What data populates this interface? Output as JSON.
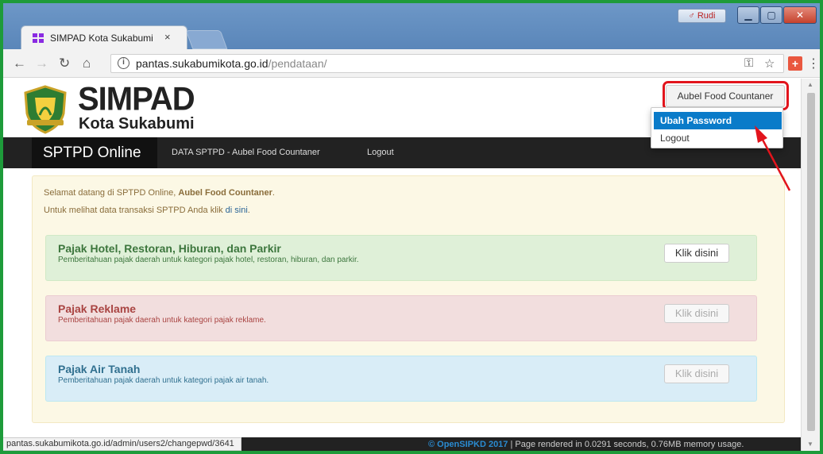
{
  "browser": {
    "tab_title": "SIMPAD Kota Sukabumi",
    "tab_close": "×",
    "profile_name": "Rudi",
    "url_host": "pantas.sukabumikota.go.id",
    "url_path": "/pendataan/",
    "status_url": "pantas.sukabumikota.go.id/admin/users2/changepwd/3641"
  },
  "header": {
    "brand_title": "SIMPAD",
    "brand_subtitle": "Kota Sukabumi",
    "user_button": "Aubel Food Countaner"
  },
  "user_dropdown": {
    "items": [
      "Ubah Password",
      "Logout"
    ]
  },
  "navbar": {
    "brand": "SPTPD Online",
    "links": [
      "DATA SPTPD - Aubel Food Countaner",
      "Logout"
    ]
  },
  "welcome": {
    "prefix": "Selamat datang di SPTPD Online, ",
    "name": "Aubel Food Countaner",
    "suffix": ".",
    "info_prefix": "Untuk melihat data transaksi SPTPD Anda klik ",
    "info_link": "di sini",
    "info_suffix": "."
  },
  "panels": [
    {
      "title": "Pajak Hotel, Restoran, Hiburan, dan Parkir",
      "description": "Pemberitahuan pajak daerah untuk kategori pajak hotel, restoran, hiburan, dan parkir.",
      "button": "Klik disini"
    },
    {
      "title": "Pajak Reklame",
      "description": "Pemberitahuan pajak daerah untuk kategori pajak reklame.",
      "button": "Klik disini"
    },
    {
      "title": "Pajak Air Tanah",
      "description": "Pemberitahuan pajak daerah untuk kategori pajak air tanah.",
      "button": "Klik disini"
    }
  ],
  "footer": {
    "copyright": "© OpenSIPKD 2017",
    "render_info": " | Page rendered in 0.0291 seconds, 0.76MB memory usage."
  },
  "colors": {
    "annotation_highlight": "#e2141c",
    "dropdown_active": "#0a7bc9",
    "navbar": "#222222"
  }
}
